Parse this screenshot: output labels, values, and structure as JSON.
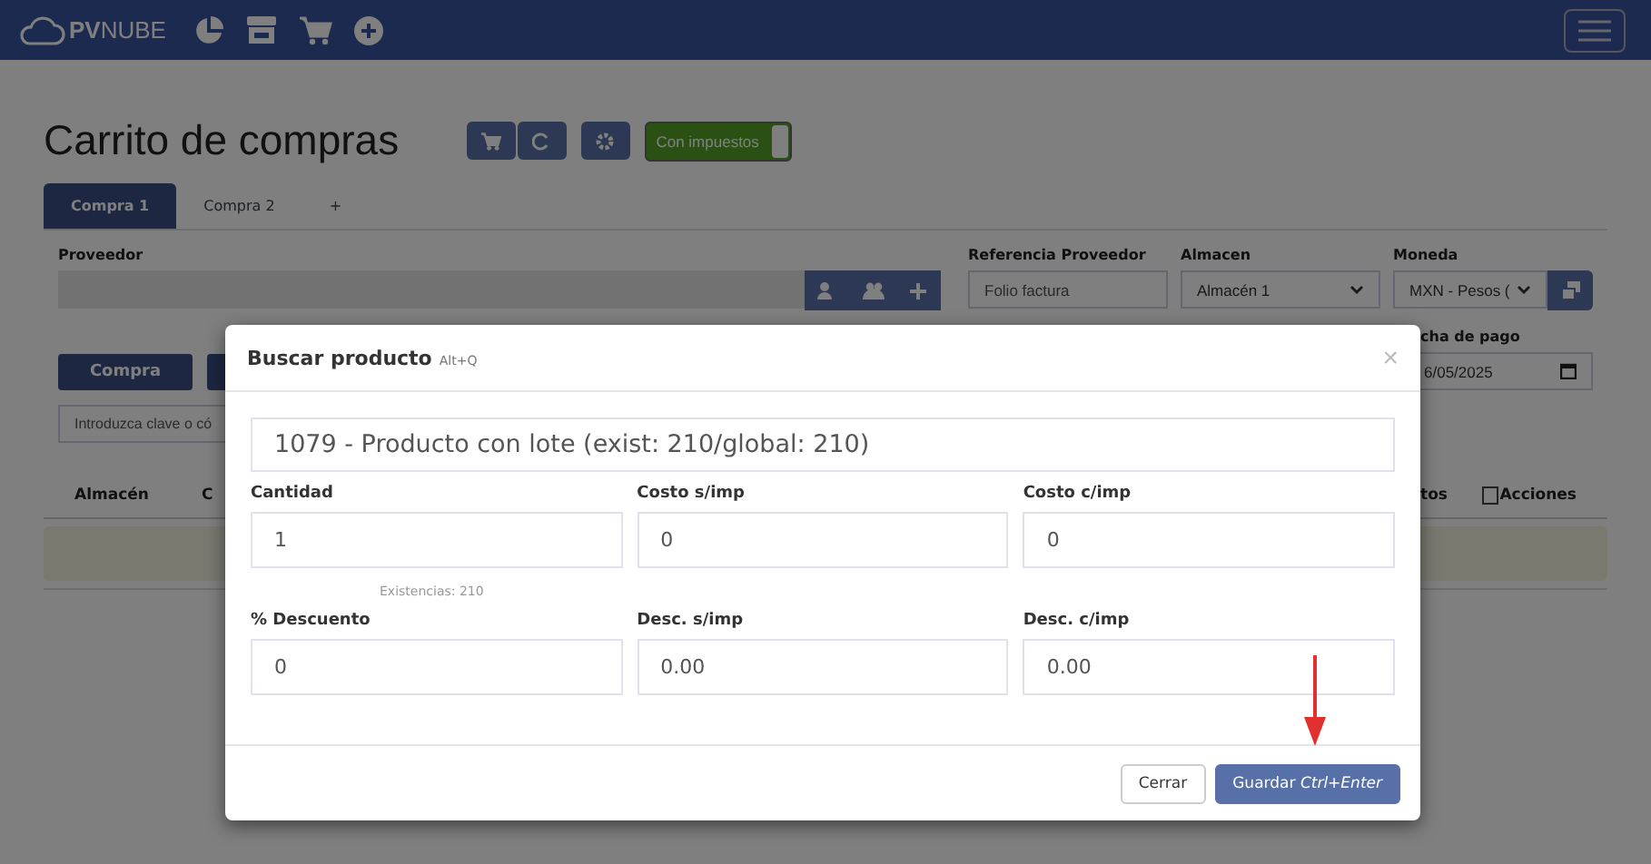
{
  "navbar": {
    "brand": "**PV**NUBE"
  },
  "page_title": "Carrito de compras",
  "tax_toggle": {
    "label": "Con impuestos",
    "on": true
  },
  "tabs": [
    {
      "label": "Compra 1",
      "selected": true
    },
    {
      "label": "Compra 2",
      "selected": false
    },
    {
      "label": "+",
      "selected": false
    }
  ],
  "form": {
    "proveedor_label": "Proveedor",
    "referencia_label": "Referencia Proveedor",
    "referencia_placeholder": "Folio factura",
    "almacen_label": "Almacen",
    "almacen_value": "Almacén 1",
    "moneda_label": "Moneda",
    "moneda_value": "MXN - Pesos (",
    "fecha_label": "cha de pago",
    "fecha_value": "6/05/2025"
  },
  "compra_button": "Compra",
  "search": {
    "placeholder": "Introduzca clave o có"
  },
  "table": {
    "columns": [
      "Almacén",
      "C",
      "tos",
      "Acciones"
    ],
    "select_all_checked": false
  },
  "modal": {
    "title": "Buscar producto",
    "shortcut": "Alt+Q",
    "close": "×",
    "product": "1079 - Producto con lote (exist: 210/global: 210)",
    "rows": [
      {
        "fields": [
          {
            "label": "Cantidad",
            "value": "1",
            "note": "Existencias: 210"
          },
          {
            "label": "Costo s/imp",
            "value": "0"
          },
          {
            "label": "Costo c/imp",
            "value": "0"
          }
        ]
      },
      {
        "fields": [
          {
            "label": "% Descuento",
            "value": "0"
          },
          {
            "label": "Desc. s/imp",
            "value": "0.00"
          },
          {
            "label": "Desc. c/imp",
            "value": "0.00"
          }
        ]
      }
    ],
    "buttons": [
      {
        "label": "Cerrar",
        "kind": "secondary"
      },
      {
        "label": "Guardar *Ctrl+Enter*",
        "kind": "primary"
      }
    ]
  }
}
